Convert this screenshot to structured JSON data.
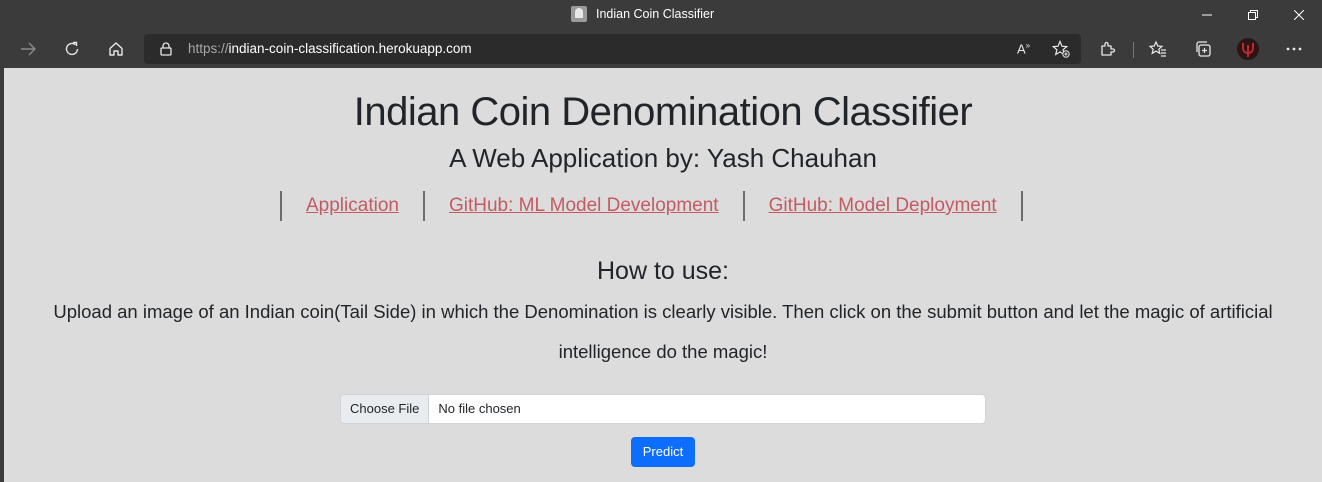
{
  "window": {
    "title": "Indian Coin Classifier",
    "favicon_icon": "coin-favicon-icon",
    "controls": [
      "minimize-icon",
      "restore-icon",
      "close-icon"
    ]
  },
  "toolbar": {
    "url_scheme": "https://",
    "url_host": "indian-coin-classification.herokuapp.com",
    "icons": [
      "forward-icon",
      "refresh-icon",
      "home-icon",
      "lock-icon",
      "read-aloud-icon",
      "add-favorite-icon",
      "extensions-icon",
      "favorites-icon",
      "collections-icon",
      "profile-icon",
      "more-icon"
    ]
  },
  "page": {
    "title": "Indian Coin Denomination Classifier",
    "subtitle": "A Web Application by: Yash Chauhan",
    "links": [
      {
        "label": "Application"
      },
      {
        "label": "GitHub: ML Model Development"
      },
      {
        "label": "GitHub: Model Deployment"
      }
    ],
    "how_heading": "How to use:",
    "instructions": "Upload an image of an Indian coin(Tail Side) in which the Denomination is clearly visible. Then click on the submit button and let the magic of artificial intelligence do the magic!",
    "file_button": "Choose File",
    "file_status": "No file chosen",
    "predict_label": "Predict"
  },
  "colors": {
    "chrome": "#3b3b3b",
    "page_bg": "#dcdcdc",
    "link": "#c45b64",
    "primary": "#0d6efd"
  }
}
